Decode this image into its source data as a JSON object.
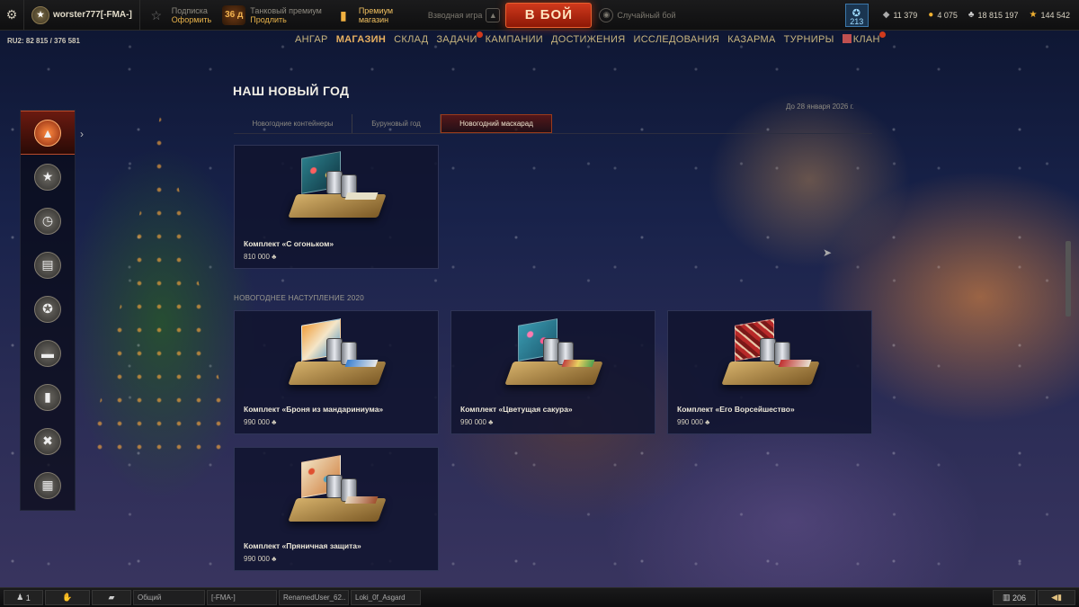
{
  "topbar": {
    "player_name": "worster777[-FMA-]",
    "subscription_label": "Подписка",
    "subscription_action": "Оформить",
    "premium_days": "36 д",
    "premium_label": "Танковый премиум",
    "premium_action": "Продлить",
    "shop_label": "Премиум магазин",
    "platoon_label": "Взводная игра",
    "battle_button": "В БОЙ",
    "mode_label": "Случайный бой",
    "rank_count": "213",
    "currencies": {
      "bonds": "11 379",
      "gold": "4 075",
      "credits": "18 815 197",
      "free_xp": "144 542"
    }
  },
  "clan_stat": "RU2: 82 815 / 376 581",
  "nav": [
    "АНГАР",
    "МАГАЗИН",
    "СКЛАД",
    "ЗАДАЧИ",
    "КАМПАНИИ",
    "ДОСТИЖЕНИЯ",
    "ИССЛЕДОВАНИЯ",
    "КАЗАРМА",
    "ТУРНИРЫ",
    "КЛАН"
  ],
  "page": {
    "title": "НАШ НОВЫЙ ГОД",
    "until": "До 28 января 2026 г.",
    "tabs": [
      "Новогодние контейнеры",
      "Буруновый год",
      "Новогодний маскарад"
    ],
    "section_2020": "НОВОГОДНЕЕ НАСТУПЛЕНИЕ 2020",
    "cards": [
      {
        "name": "Комплект «С огоньком»",
        "price": "810 000"
      },
      {
        "name": "Комплект «Броня из мандариниума»",
        "price": "990 000"
      },
      {
        "name": "Комплект «Цветущая сакура»",
        "price": "990 000"
      },
      {
        "name": "Комплект «Его Ворсейшество»",
        "price": "990 000"
      },
      {
        "name": "Комплект «Пряничная защита»",
        "price": "990 000"
      }
    ]
  },
  "bottom": {
    "platoon_count": "1",
    "channels": [
      "Общий",
      "[-FMA-]",
      "RenamedUser_62..",
      "Loki_0f_Asgard"
    ],
    "garage_count": "206"
  },
  "colors": {
    "accent": "#e8b060",
    "battle": "#c6321a",
    "card_bg": "#10142e"
  }
}
